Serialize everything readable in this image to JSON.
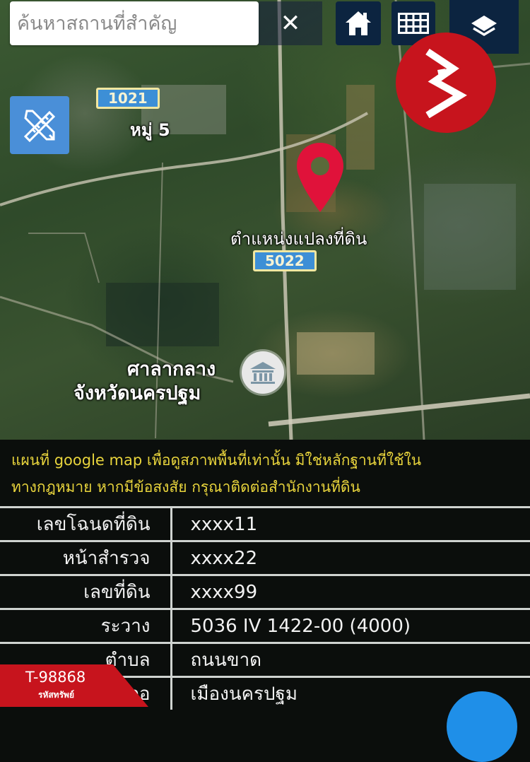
{
  "search": {
    "placeholder": "ค้นหาสถานที่สำคัญ",
    "clear_icon": "close-icon"
  },
  "toolbar": {
    "home_icon": "home-icon",
    "grid_icon": "grid-icon",
    "layers_icon": "layers-icon",
    "tools_icon": "ruler-pencil-icon"
  },
  "colors": {
    "toolbar_bg": "#0c2440",
    "brand_red": "#c7141d",
    "pin_red": "#e0123a",
    "disclaimer_yellow": "#e8d43c",
    "shield_blue": "#3d8fd6"
  },
  "map": {
    "road_1021": "1021",
    "road_5022": "5022",
    "village_label": "หมู่ 5",
    "pin_label": "ตำแหน่งแปลงที่ดิน",
    "landmark_line1": "ศาลากลาง",
    "landmark_line2": "จังหวัดนครปฐม"
  },
  "disclaimer": {
    "line1": "แผนที่ google map เพื่อดูสภาพพื้นที่เท่านั้น มิใช่หลักฐานที่ใช้ใน",
    "line2": "ทางกฎหมาย หากมีข้อสงสัย กรุณาติดต่อสำนักงานที่ดิน"
  },
  "land_info": [
    {
      "label": "เลขโฉนดที่ดิน",
      "value": "xxxx11"
    },
    {
      "label": "หน้าสำรวจ",
      "value": "xxxx22"
    },
    {
      "label": "เลขที่ดิน",
      "value": "xxxx99"
    },
    {
      "label": "ระวาง",
      "value": "5036 IV 1422-00 (4000)"
    },
    {
      "label": "ตำบล",
      "value": "ถนนขาด"
    },
    {
      "label": "อำเภอ",
      "value": "เมืองนครปฐม"
    }
  ],
  "asset_tag": {
    "code": "T-98868",
    "label": "รหัสทรัพย์"
  }
}
